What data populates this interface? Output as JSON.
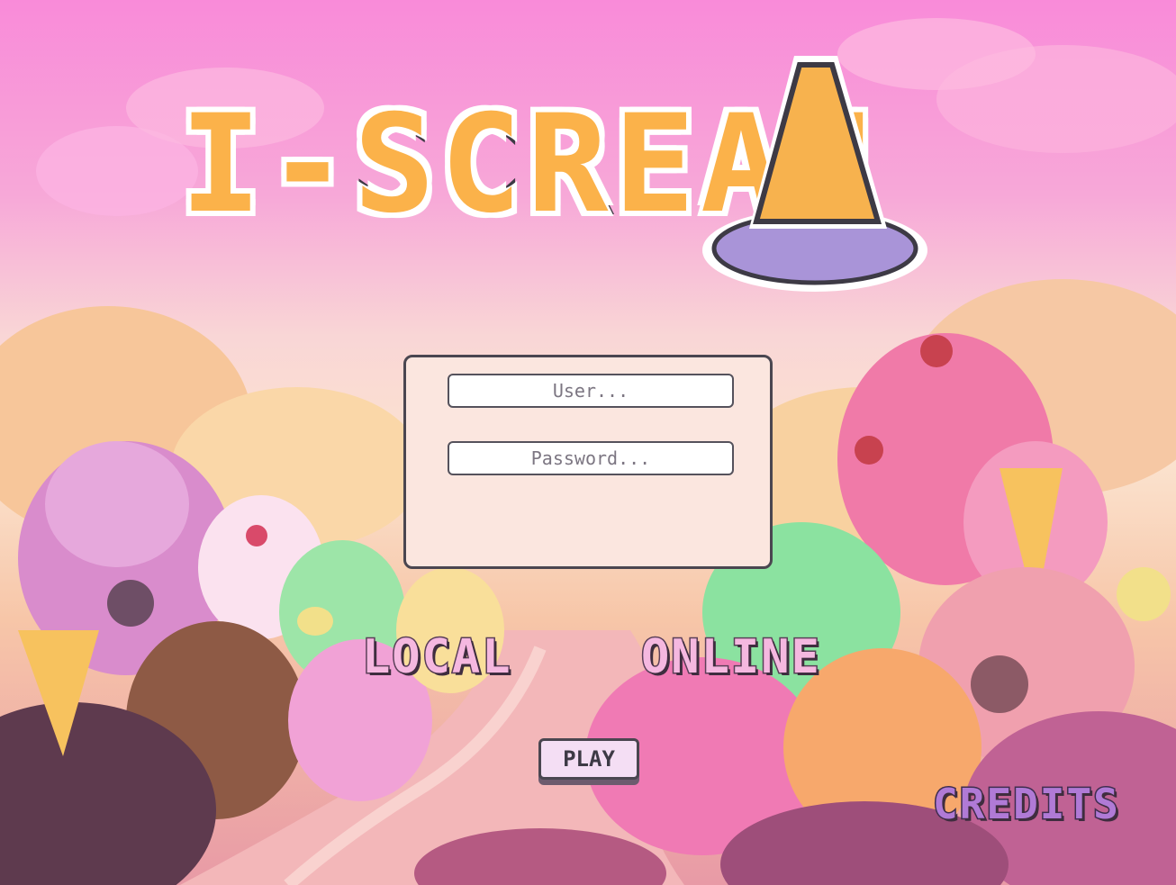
{
  "game": {
    "title": "I-SCREAM",
    "title_color": "#fbb24a",
    "outline_color": "#3d3a45"
  },
  "login": {
    "user_placeholder": "User...",
    "password_placeholder": "Password...",
    "user_value": "",
    "password_value": ""
  },
  "menu": {
    "local_label": "LOCAL",
    "online_label": "ONLINE",
    "play_label": "PLAY",
    "credits_label": "CREDITS"
  },
  "colors": {
    "sky_top": "#f98bd9",
    "panel_bg": "#fbe6df",
    "label_pink": "#f5b8e0",
    "credits_purple": "#b07ad6"
  },
  "icons": [
    "ice-cream-cone-icon",
    "cherry-icon",
    "lemon-slice-icon"
  ]
}
